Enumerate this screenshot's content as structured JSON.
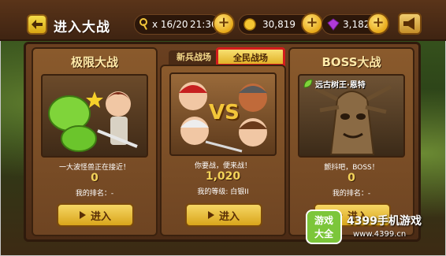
{
  "header": {
    "title": "进入大战",
    "keys": "x 16/20",
    "timer": "21:36",
    "gold": "30,819",
    "gems": "3,182"
  },
  "tabs": [
    "新兵战场",
    "全民战场"
  ],
  "cards": [
    {
      "title": "极限大战",
      "caption": "一大波怪兽正在接近！",
      "count": "0",
      "rank": "我的排名：-",
      "button": "进入"
    },
    {
      "title": "",
      "caption": "你要战，便来战！",
      "count": "1,020",
      "rank": "我的等级: 白银II",
      "button": "进入",
      "vs": "VS"
    },
    {
      "title": "BOSS大战",
      "boss_name": "远古树王·恩特",
      "caption": "颤抖吧，BOSS！",
      "count": "0",
      "rank": "我的排名：-",
      "button": "进入"
    }
  ],
  "watermark": {
    "badge_top": "游戏",
    "badge_bottom": "大全",
    "text": "4399手机游戏",
    "sub": "www.4399.cn"
  },
  "colors": {
    "accent_gold": "#f3d35a",
    "tab_active": "#d31c1c",
    "wood": "#6e4422"
  }
}
